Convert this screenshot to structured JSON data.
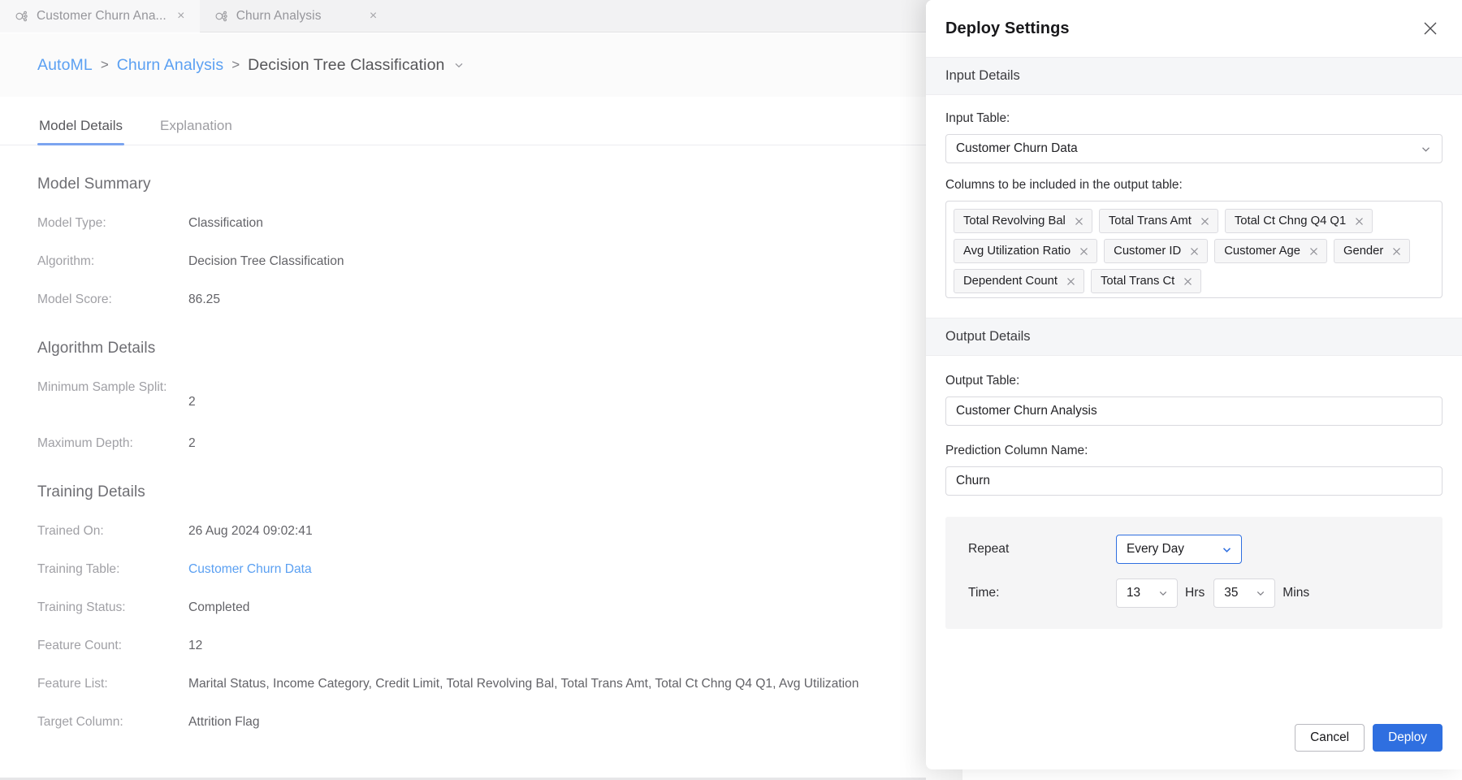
{
  "tabs": [
    {
      "title": "Customer Churn Ana...",
      "icon": "model-node-icon",
      "close": "×",
      "active": true
    },
    {
      "title": "Churn Analysis",
      "icon": "model-node-icon",
      "close": "×",
      "active": false
    }
  ],
  "breadcrumb": {
    "items": [
      "AutoML",
      "Churn Analysis",
      "Decision Tree Classification"
    ],
    "separator": ">"
  },
  "subtabs": [
    {
      "label": "Model Details",
      "active": true
    },
    {
      "label": "Explanation",
      "active": false
    }
  ],
  "main": {
    "model_summary_heading": "Model Summary",
    "model_summary": [
      {
        "key": "Model Type:",
        "value": "Classification"
      },
      {
        "key": "Algorithm:",
        "value": "Decision Tree Classification"
      },
      {
        "key": "Model Score:",
        "value": "86.25"
      }
    ],
    "algorithm_heading": "Algorithm Details",
    "algorithm_details": [
      {
        "key": "Minimum Sample Split:",
        "value": "2"
      },
      {
        "key": "Maximum Depth:",
        "value": "2"
      }
    ],
    "training_heading": "Training Details",
    "training_details": [
      {
        "key": "Trained On:",
        "value": "26 Aug 2024 09:02:41"
      },
      {
        "key": "Training Table:",
        "value": "Customer Churn Data",
        "link": true
      },
      {
        "key": "Training Status:",
        "value": "Completed"
      },
      {
        "key": "Feature Count:",
        "value": "12"
      },
      {
        "key": "Feature List:",
        "value": "Marital Status, Income Category, Credit Limit, Total Revolving Bal, Total Trans Amt, Total Ct Chng Q4 Q1, Avg Utilization"
      },
      {
        "key": "Target Column:",
        "value": "Attrition Flag"
      }
    ]
  },
  "dialog": {
    "title": "Deploy Settings",
    "close_icon": "close-icon",
    "input_section": "Input Details",
    "input_table_label": "Input Table:",
    "input_table_value": "Customer Churn Data",
    "columns_label": "Columns to be included in the output table:",
    "columns": [
      "Total Revolving Bal",
      "Total Trans Amt",
      "Total Ct Chng Q4 Q1",
      "Avg Utilization Ratio",
      "Customer ID",
      "Customer Age",
      "Gender",
      "Dependent Count",
      "Total Trans Ct"
    ],
    "output_section": "Output Details",
    "output_table_label": "Output Table:",
    "output_table_value": "Customer Churn Analysis",
    "prediction_label": "Prediction Column Name:",
    "prediction_value": "Churn",
    "repeat_label": "Repeat",
    "repeat_value": "Every Day",
    "time_label": "Time:",
    "hours_value": "13",
    "hours_unit": "Hrs",
    "minutes_value": "35",
    "minutes_unit": "Mins",
    "cancel_label": "Cancel",
    "deploy_label": "Deploy"
  },
  "colors": {
    "accent": "#2f6fe0",
    "link": "#5ba0f2",
    "tab_underline": "#7ba4f0",
    "band_bg": "#f5f6f8",
    "schedule_bg": "#f5f5f6"
  }
}
